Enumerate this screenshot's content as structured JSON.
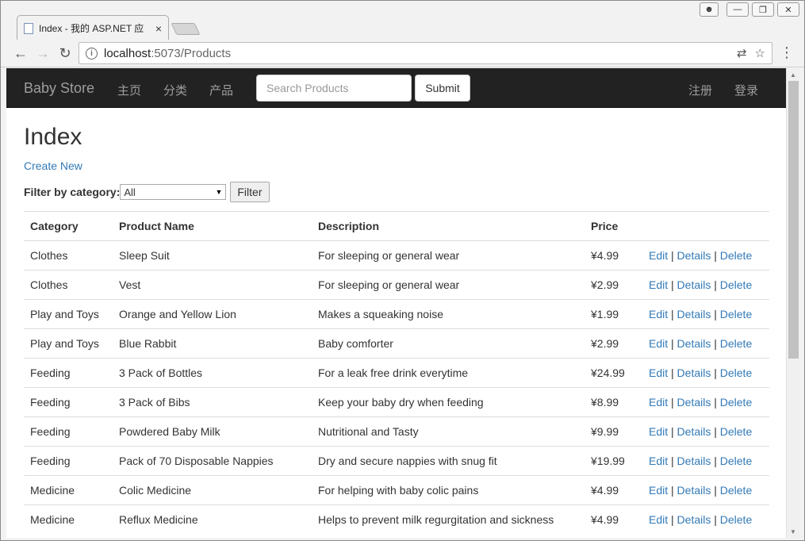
{
  "browser": {
    "tab_title": "Index - 我的 ASP.NET 应",
    "tab_close": "×",
    "url_host": "localhost",
    "url_rest": ":5073/Products"
  },
  "site": {
    "brand": "Baby Store",
    "nav": [
      "主页",
      "分类",
      "产品"
    ],
    "search_placeholder": "Search Products",
    "submit_label": "Submit",
    "register": "注册",
    "login": "登录"
  },
  "page": {
    "title": "Index",
    "create_new": "Create New",
    "filter_label": "Filter by category:",
    "filter_selected": "All",
    "filter_button": "Filter"
  },
  "table": {
    "headers": [
      "Category",
      "Product Name",
      "Description",
      "Price"
    ],
    "action_labels": {
      "edit": "Edit",
      "details": "Details",
      "delete": "Delete",
      "sep": "|"
    },
    "rows": [
      [
        "Clothes",
        "Sleep Suit",
        "For sleeping or general wear",
        "¥4.99"
      ],
      [
        "Clothes",
        "Vest",
        "For sleeping or general wear",
        "¥2.99"
      ],
      [
        "Play and Toys",
        "Orange and Yellow Lion",
        "Makes a squeaking noise",
        "¥1.99"
      ],
      [
        "Play and Toys",
        "Blue Rabbit",
        "Baby comforter",
        "¥2.99"
      ],
      [
        "Feeding",
        "3 Pack of Bottles",
        "For a leak free drink everytime",
        "¥24.99"
      ],
      [
        "Feeding",
        "3 Pack of Bibs",
        "Keep your baby dry when feeding",
        "¥8.99"
      ],
      [
        "Feeding",
        "Powdered Baby Milk",
        "Nutritional and Tasty",
        "¥9.99"
      ],
      [
        "Feeding",
        "Pack of 70 Disposable Nappies",
        "Dry and secure nappies with snug fit",
        "¥19.99"
      ],
      [
        "Medicine",
        "Colic Medicine",
        "For helping with baby colic pains",
        "¥4.99"
      ],
      [
        "Medicine",
        "Reflux Medicine",
        "Helps to prevent milk regurgitation and sickness",
        "¥4.99"
      ]
    ]
  },
  "colors": {
    "navbar_bg": "#222222",
    "navbar_text": "#9d9d9d",
    "link": "#337ab7",
    "text": "#333333"
  }
}
